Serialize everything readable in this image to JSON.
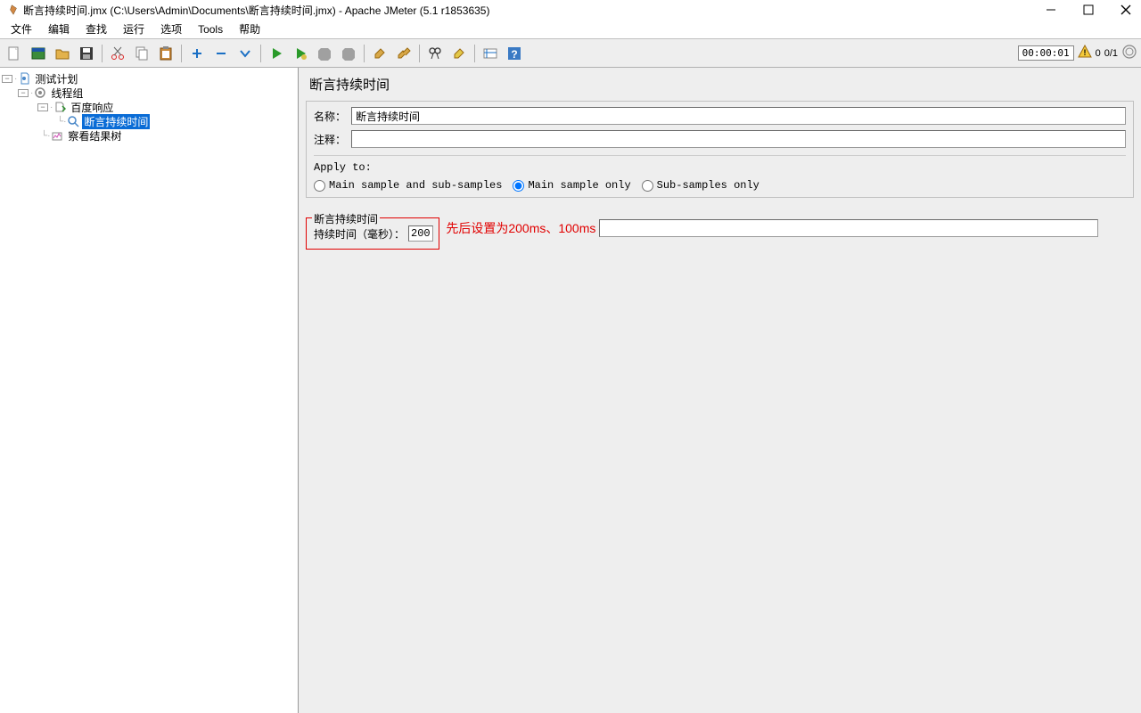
{
  "window": {
    "title": "断言持续时间.jmx (C:\\Users\\Admin\\Documents\\断言持续时间.jmx) - Apache JMeter (5.1 r1853635)"
  },
  "menubar": {
    "file": "文件",
    "edit": "编辑",
    "search": "查找",
    "run": "运行",
    "options": "选项",
    "tools": "Tools",
    "help": "帮助"
  },
  "toolbar_status": {
    "timer": "00:00:01",
    "warnings": "0",
    "threads": "0/1"
  },
  "tree": {
    "plan": "测试计划",
    "thread_group": "线程组",
    "sampler": "百度响应",
    "assertion": "断言持续时间",
    "listener": "察看结果树"
  },
  "editor": {
    "title": "断言持续时间",
    "name_label": "名称：",
    "name_value": "断言持续时间",
    "comment_label": "注释：",
    "comment_value": "",
    "apply_to_label": "Apply to:",
    "radio_main_sub": "Main sample and sub-samples",
    "radio_main": "Main sample only",
    "radio_sub": "Sub-samples only",
    "duration_legend": "断言持续时间",
    "duration_label": "持续时间（毫秒）：",
    "duration_value": "200",
    "annotation": "先后设置为200ms、100ms"
  }
}
